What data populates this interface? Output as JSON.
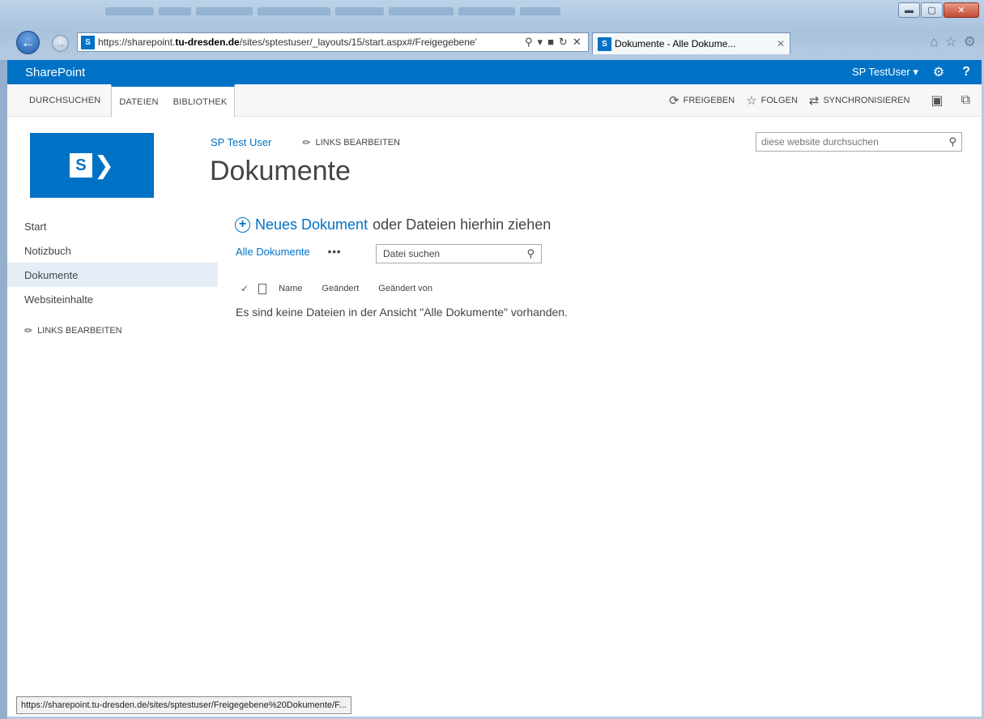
{
  "browser": {
    "url_prefix": "https://sharepoint.",
    "url_domain": "tu-dresden.de",
    "url_path": "/sites/sptestuser/_layouts/15/start.aspx#/Freigegebene'",
    "tab_title": "Dokumente - Alle Dokume...",
    "status_url": "https://sharepoint.tu-dresden.de/sites/sptestuser/Freigegebene%20Dokumente/F...",
    "favicon_label": "S"
  },
  "suite": {
    "brand": "SharePoint",
    "user": "SP TestUser ▾",
    "help": "?"
  },
  "ribbon": {
    "tabs": [
      "DURCHSUCHEN",
      "DATEIEN",
      "BIBLIOTHEK"
    ],
    "share": "FREIGEBEN",
    "follow": "FOLGEN",
    "sync": "SYNCHRONISIEREN"
  },
  "header": {
    "site_link": "SP Test User",
    "edit_links": "LINKS BEARBEITEN",
    "page_title": "Dokumente",
    "search_placeholder": "diese website durchsuchen",
    "logo_letter": "S"
  },
  "quicklaunch": {
    "items": [
      "Start",
      "Notizbuch",
      "Dokumente",
      "Websiteinhalte"
    ],
    "edit_links": "LINKS BEARBEITEN"
  },
  "library": {
    "new_doc_link": "Neues Dokument",
    "new_doc_rest": "oder Dateien hierhin ziehen",
    "view_name": "Alle Dokumente",
    "more": "•••",
    "file_search_placeholder": "Datei suchen",
    "columns": [
      "Name",
      "Geändert",
      "Geändert von"
    ],
    "empty_message": "Es sind keine Dateien in der Ansicht \"Alle Dokumente\" vorhanden."
  }
}
